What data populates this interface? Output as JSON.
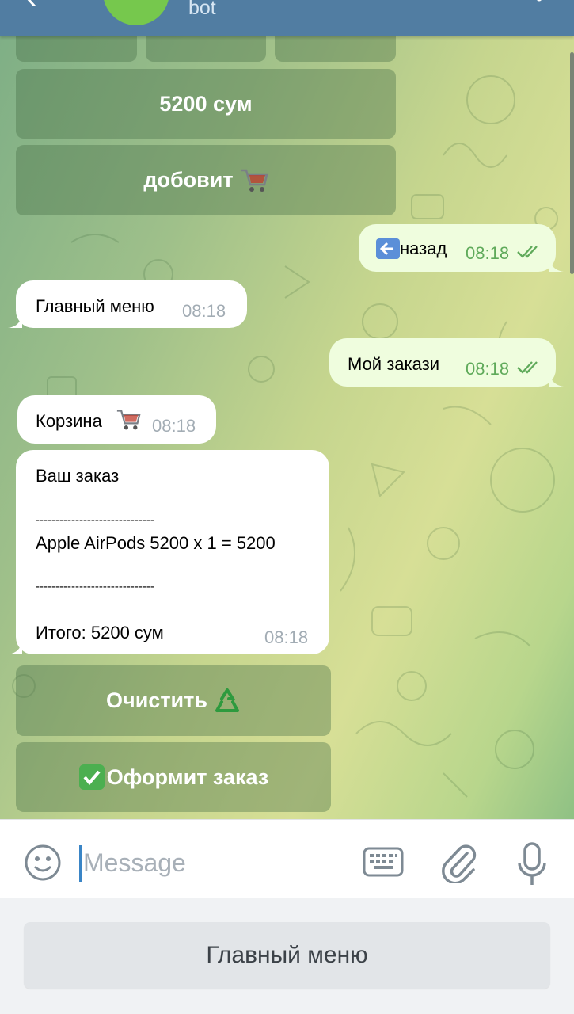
{
  "header": {
    "subtitle": "bot"
  },
  "inline_keyboard_top": {
    "price_button": "5200 сум",
    "add_button": "добовит"
  },
  "messages": [
    {
      "id": "back",
      "text": "назад",
      "time": "08:18",
      "direction": "out",
      "icon": "back-arrow-emoji",
      "status": "read"
    },
    {
      "id": "main_menu",
      "text": "Главный меню",
      "time": "08:18",
      "direction": "in"
    },
    {
      "id": "my_orders",
      "text": "Мой закази",
      "time": "08:18",
      "direction": "out",
      "status": "read"
    },
    {
      "id": "cart",
      "text": "Корзина",
      "time": "08:18",
      "direction": "in",
      "icon": "shopping-cart-emoji"
    },
    {
      "id": "order",
      "time": "08:18",
      "direction": "in",
      "lines": {
        "title": "Ваш заказ",
        "separator": "------------------------------",
        "item": "Apple AirPods 5200 x 1 = 5200",
        "total": "Итого: 5200 сум"
      }
    }
  ],
  "inline_keyboard_bottom": {
    "clear_button": "Очистить",
    "checkout_button": "Оформит заказ"
  },
  "input": {
    "placeholder": "Message"
  },
  "reply_keyboard": {
    "main_menu_button": "Главный меню"
  },
  "colors": {
    "header": "#517da2",
    "outgoing_bubble": "#effdde",
    "incoming_bubble": "#ffffff",
    "read_ticks": "#5faa5a",
    "avatar": "#76c84d"
  }
}
